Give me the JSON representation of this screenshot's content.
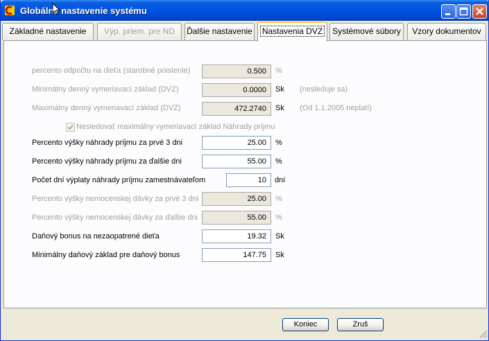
{
  "window": {
    "title": "Globálne nastavenie systému"
  },
  "titlebar_buttons": {
    "minimize": "minimize-icon",
    "maximize": "maximize-icon",
    "close": "close-icon"
  },
  "tabs": [
    {
      "label": "Základné nastavenie",
      "state": "normal"
    },
    {
      "label": "Výp. priem. pre ND",
      "state": "disabled"
    },
    {
      "label": "Ďalšie nastavenie",
      "state": "normal"
    },
    {
      "label": "Nastavenia DVZ",
      "state": "active"
    },
    {
      "label": "Systémové súbory",
      "state": "normal"
    },
    {
      "label": "Vzory dokumentov",
      "state": "normal"
    }
  ],
  "rows": [
    {
      "label": "percento odpočtu na dieťa (starobné poistenie)",
      "value": "0.500",
      "unit": "%",
      "note": "",
      "enabled": false
    },
    {
      "label": "Minimálny denný vymeriavací základ (DVZ)",
      "value": "0.0000",
      "unit": "Sk",
      "note": "(nesleduje sa)",
      "enabled": false
    },
    {
      "label": "Maximálny denný vymeriavací základ (DVZ)",
      "value": "472.2740",
      "unit": "Sk",
      "note": "(Od 1.1.2005 neplatí)",
      "enabled": false
    },
    {
      "label": "Percento výšky náhrady príjmu za prvé 3 dni",
      "value": "25.00",
      "unit": "%",
      "note": "",
      "enabled": true
    },
    {
      "label": "Percento výšky náhrady príjmu za ďalšie dni",
      "value": "55.00",
      "unit": "%",
      "note": "",
      "enabled": true
    },
    {
      "label": "Počet dní výplaty náhrady príjmu zamestnávateľom",
      "value": "10",
      "unit": "dní",
      "note": "",
      "enabled": true
    },
    {
      "label": "Percento výšky nemocenskej dávky za prvé 3 dni",
      "value": "25.00",
      "unit": "%",
      "note": "",
      "enabled": false
    },
    {
      "label": "Percento výšky nemocenskej dávky za ďalšie dni",
      "value": "55.00",
      "unit": "%",
      "note": "",
      "enabled": false
    },
    {
      "label": "Daňový bonus na nezaopatrené dieťa",
      "value": "19.32",
      "unit": "Sk",
      "note": "",
      "enabled": true
    },
    {
      "label": "Minimálny daňový základ pre daňový bonus",
      "value": "147.75",
      "unit": "Sk",
      "note": "",
      "enabled": true
    }
  ],
  "checkbox": {
    "label": "Nesledovať maximálny vymeriavací základ Náhrady príjmu",
    "checked": true,
    "enabled": false
  },
  "buttons": {
    "ok": "Koniec",
    "cancel": "Zruš"
  }
}
